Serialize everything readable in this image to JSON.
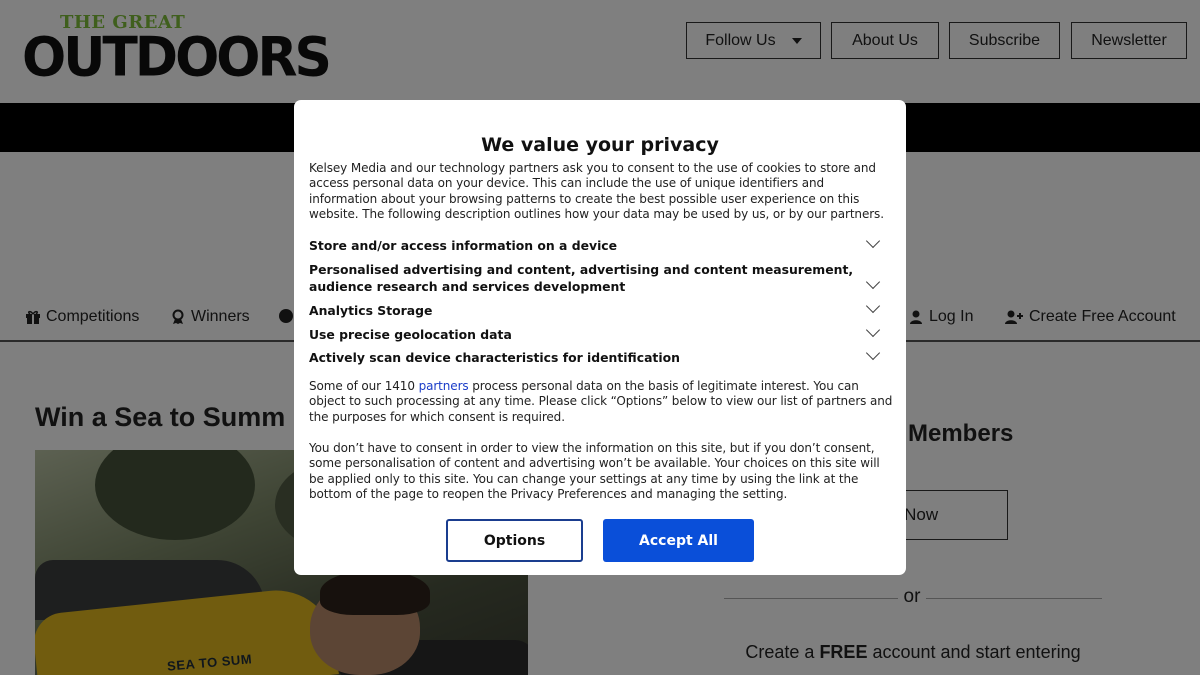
{
  "site": {
    "logo_top": "THE GREAT",
    "logo_main": "OUTDOORS"
  },
  "header_nav": {
    "follow_us": "Follow Us",
    "about_us": "About Us",
    "subscribe": "Subscribe",
    "newsletter": "Newsletter"
  },
  "subnav": {
    "competitions": "Competitions",
    "winners": "Winners",
    "log_in": "Log In",
    "create_account": "Create Free Account"
  },
  "article": {
    "headline": "Win a Sea to Summ",
    "hero_brand": "SEA TO SUM"
  },
  "sidebar": {
    "members_title": "Members",
    "join_label": "n Now",
    "or": "or",
    "create_prefix": "Create a ",
    "create_bold": "FREE",
    "create_suffix": " account and start entering"
  },
  "consent": {
    "title": "We value your privacy",
    "intro": "Kelsey Media and our technology partners ask you to consent to the use of cookies to store and access personal data on your device. This can include the use of unique identifiers and information about your browsing patterns to create the best possible user experience on this website. The following description outlines how your data may be used by us, or by our partners.",
    "purposes": [
      "Store and/or access information on a device",
      "Personalised advertising and content, advertising and content measurement, audience research and services development",
      "Analytics Storage",
      "Use precise geolocation data",
      "Actively scan device characteristics for identification"
    ],
    "legit_prefix": "Some of our 1410 ",
    "legit_link": "partners",
    "legit_suffix": " process personal data on the basis of legitimate interest. You can object to such processing at any time. Please click “Options” below to view our list of partners and the purposes for which consent is required.",
    "no_consent": "You don’t have to consent in order to view the information on this site, but if you don’t consent, some personalisation of content and advertising won’t be available. Your choices on this site will be applied only to this site. You can change your settings at any time by using the link at the bottom of the page to reopen the Privacy Preferences and managing the setting.",
    "options_label": "Options",
    "accept_label": "Accept All"
  },
  "colors": {
    "accept_button": "#0a4fd9",
    "options_border": "#1a3d8f",
    "link": "#1a3cc8",
    "logo_green": "#7fbf3a"
  }
}
